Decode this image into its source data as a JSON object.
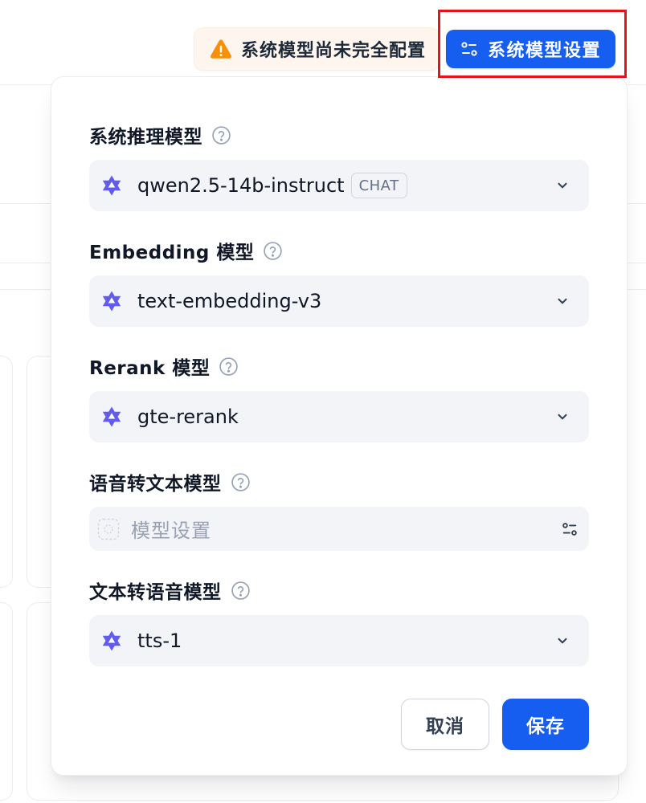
{
  "header": {
    "warning_text": "系统模型尚未完全配置",
    "settings_button_label": "系统模型设置"
  },
  "panel": {
    "fields": [
      {
        "label": "系统推理模型",
        "value": "qwen2.5-14b-instruct",
        "badge": "CHAT"
      },
      {
        "label": "Embedding 模型",
        "value": "text-embedding-v3"
      },
      {
        "label": "Rerank 模型",
        "value": "gte-rerank"
      },
      {
        "label": "语音转文本模型",
        "placeholder": "模型设置"
      },
      {
        "label": "文本转语音模型",
        "value": "tts-1"
      }
    ],
    "cancel_label": "取消",
    "save_label": "保存"
  },
  "icons": {
    "warning": "warning-icon",
    "settings": "settings-sliders-icon",
    "model": "qwen-model-icon",
    "help": "help-circle-icon",
    "chevron": "chevron-down-icon",
    "placeholder": "model-placeholder-icon"
  },
  "colors": {
    "accent": "#155eef",
    "warning": "#f79009",
    "highlight": "#e5141b",
    "select_background": "#f2f4f7"
  }
}
